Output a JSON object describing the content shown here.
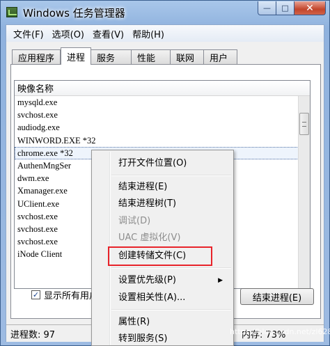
{
  "window": {
    "title": "Windows 任务管理器",
    "min_glyph": "—",
    "max_glyph": "□",
    "close_glyph": "✕"
  },
  "menubar": [
    "文件(F)",
    "选项(O)",
    "查看(V)",
    "帮助(H)"
  ],
  "tabs": [
    {
      "label": "应用程序",
      "active": false
    },
    {
      "label": "进程",
      "active": true
    },
    {
      "label": "服务",
      "active": false
    },
    {
      "label": "性能",
      "active": false
    },
    {
      "label": "联网",
      "active": false
    },
    {
      "label": "用户",
      "active": false
    }
  ],
  "process_list": {
    "column_header": "映像名称",
    "rows": [
      "mysqld.exe",
      "svchost.exe",
      "audiodg.exe",
      "WINWORD.EXE *32",
      "chrome.exe *32",
      "AuthenMngSer",
      "dwm.exe",
      "Xmanager.exe",
      "UClient.exe",
      "svchost.exe",
      "svchost.exe",
      "svchost.exe",
      "iNode Client"
    ],
    "selected_index": 4
  },
  "show_all": {
    "label": "显示所有用户",
    "check_glyph": "✓"
  },
  "end_process_button": "结束进程(E)",
  "status": {
    "processes": "进程数: 97",
    "memory": "内存: 73%"
  },
  "context_menu": {
    "items": [
      {
        "label": "打开文件位置(O)",
        "enabled": true
      },
      {
        "label": "结束进程(E)",
        "enabled": true
      },
      {
        "label": "结束进程树(T)",
        "enabled": true
      },
      {
        "label": "调试(D)",
        "enabled": false
      },
      {
        "label": "UAC 虚拟化(V)",
        "enabled": false
      },
      {
        "label": "创建转储文件(C)",
        "enabled": true
      },
      {
        "label": "设置优先级(P)",
        "enabled": true
      },
      {
        "label": "设置相关性(A)...",
        "enabled": true
      },
      {
        "label": "属性(R)",
        "enabled": true
      },
      {
        "label": "转到服务(S)",
        "enabled": true
      }
    ],
    "submenu_arrow": "▶"
  },
  "watermark": "https://blog.csdn.net/zl628"
}
